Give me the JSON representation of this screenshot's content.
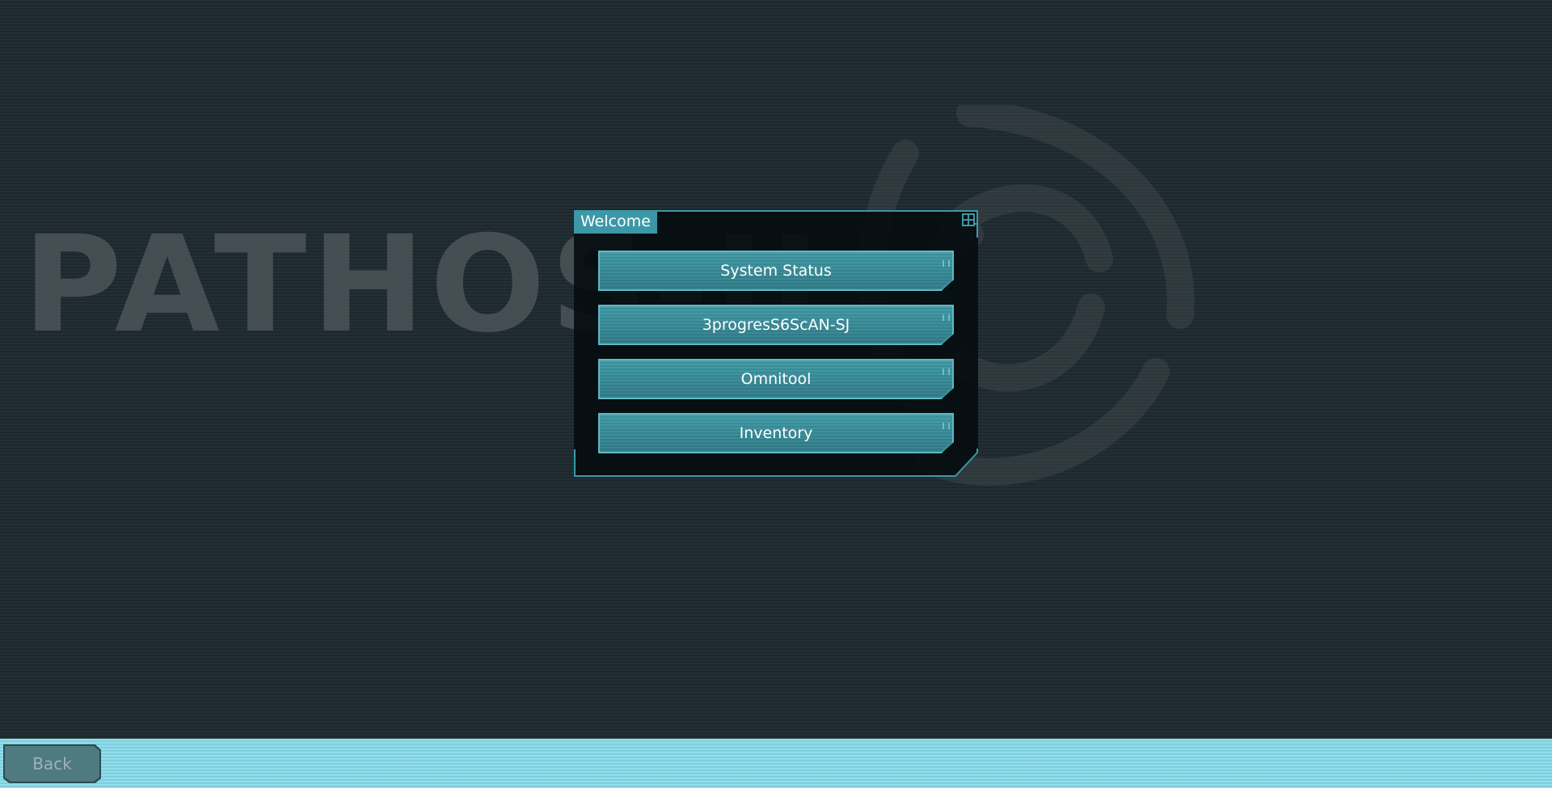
{
  "background": {
    "wordmark": "PATHOS-II",
    "emblem_icon": "pathos-emblem-icon"
  },
  "dialog": {
    "title": "Welcome",
    "corner_icon": "window-corner-icon",
    "buttons": [
      {
        "label": "System Status"
      },
      {
        "label": "3progresS6ScAN-SJ"
      },
      {
        "label": "Omnitool"
      },
      {
        "label": "Inventory"
      }
    ]
  },
  "footer": {
    "back_label": "Back"
  },
  "colors": {
    "background": "#1f2a30",
    "accent": "#3c98a6",
    "button": "#3f8e99",
    "bottom_bar": "#7fd6e6",
    "back_button": "#4e7a80"
  }
}
